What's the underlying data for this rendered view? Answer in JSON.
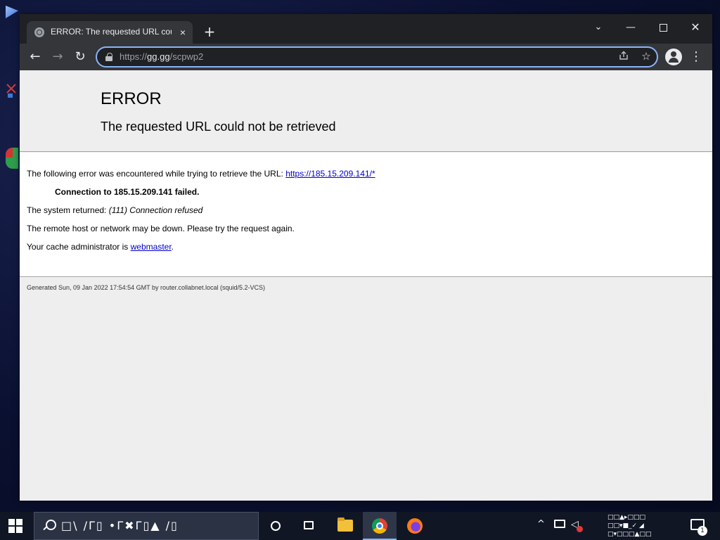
{
  "browser": {
    "tab_title": "ERROR: The requested URL could not be retrieved",
    "tab_close": "×",
    "new_tab": "+",
    "window_controls": {
      "dropdown": "⌄",
      "minimize": "—",
      "close": "✕"
    },
    "nav": {
      "back": "←",
      "forward": "→",
      "reload": "↻"
    },
    "url": {
      "scheme": "https://",
      "host": "gg.gg",
      "path": "/scpwp2"
    },
    "omnibox_icons": {
      "share": "share-icon",
      "bookmark": "☆"
    },
    "menu": "⋮"
  },
  "page": {
    "title": "ERROR",
    "subtitle": "The requested URL could not be retrieved",
    "line1_prefix": "The following error was encountered while trying to retrieve the URL: ",
    "line1_link": "https://185.15.209.141/*",
    "line2": "Connection to 185.15.209.141 failed.",
    "line3_prefix": "The system returned: ",
    "line3_error": "(111) Connection refused",
    "line4": "The remote host or network may be down. Please try the request again.",
    "line5_prefix": "Your cache administrator is ",
    "line5_link": "webmaster",
    "line5_suffix": ".",
    "footer": "Generated Sun, 09 Jan 2022 17:54:54 GMT by router.collabnet.local (squid/5.2-VCS)"
  },
  "taskbar": {
    "search_glyphs": "□\\ /Γ▯ •Γ✖Γ▯▲ /▯",
    "tray": {
      "chevron": "^",
      "volume": "◁",
      "clock_line1": "□□▲▸□□□",
      "clock_line2": "□□▾■_✓ ◢",
      "clock_line3": "□▾□□□▲□□",
      "notification_count": "1"
    }
  },
  "colors": {
    "titlebar": "#202124",
    "toolbar": "#35363a",
    "omnibox_border": "#8ab4f8",
    "page_bg": "#eeeeee",
    "link": "#0000cc"
  }
}
